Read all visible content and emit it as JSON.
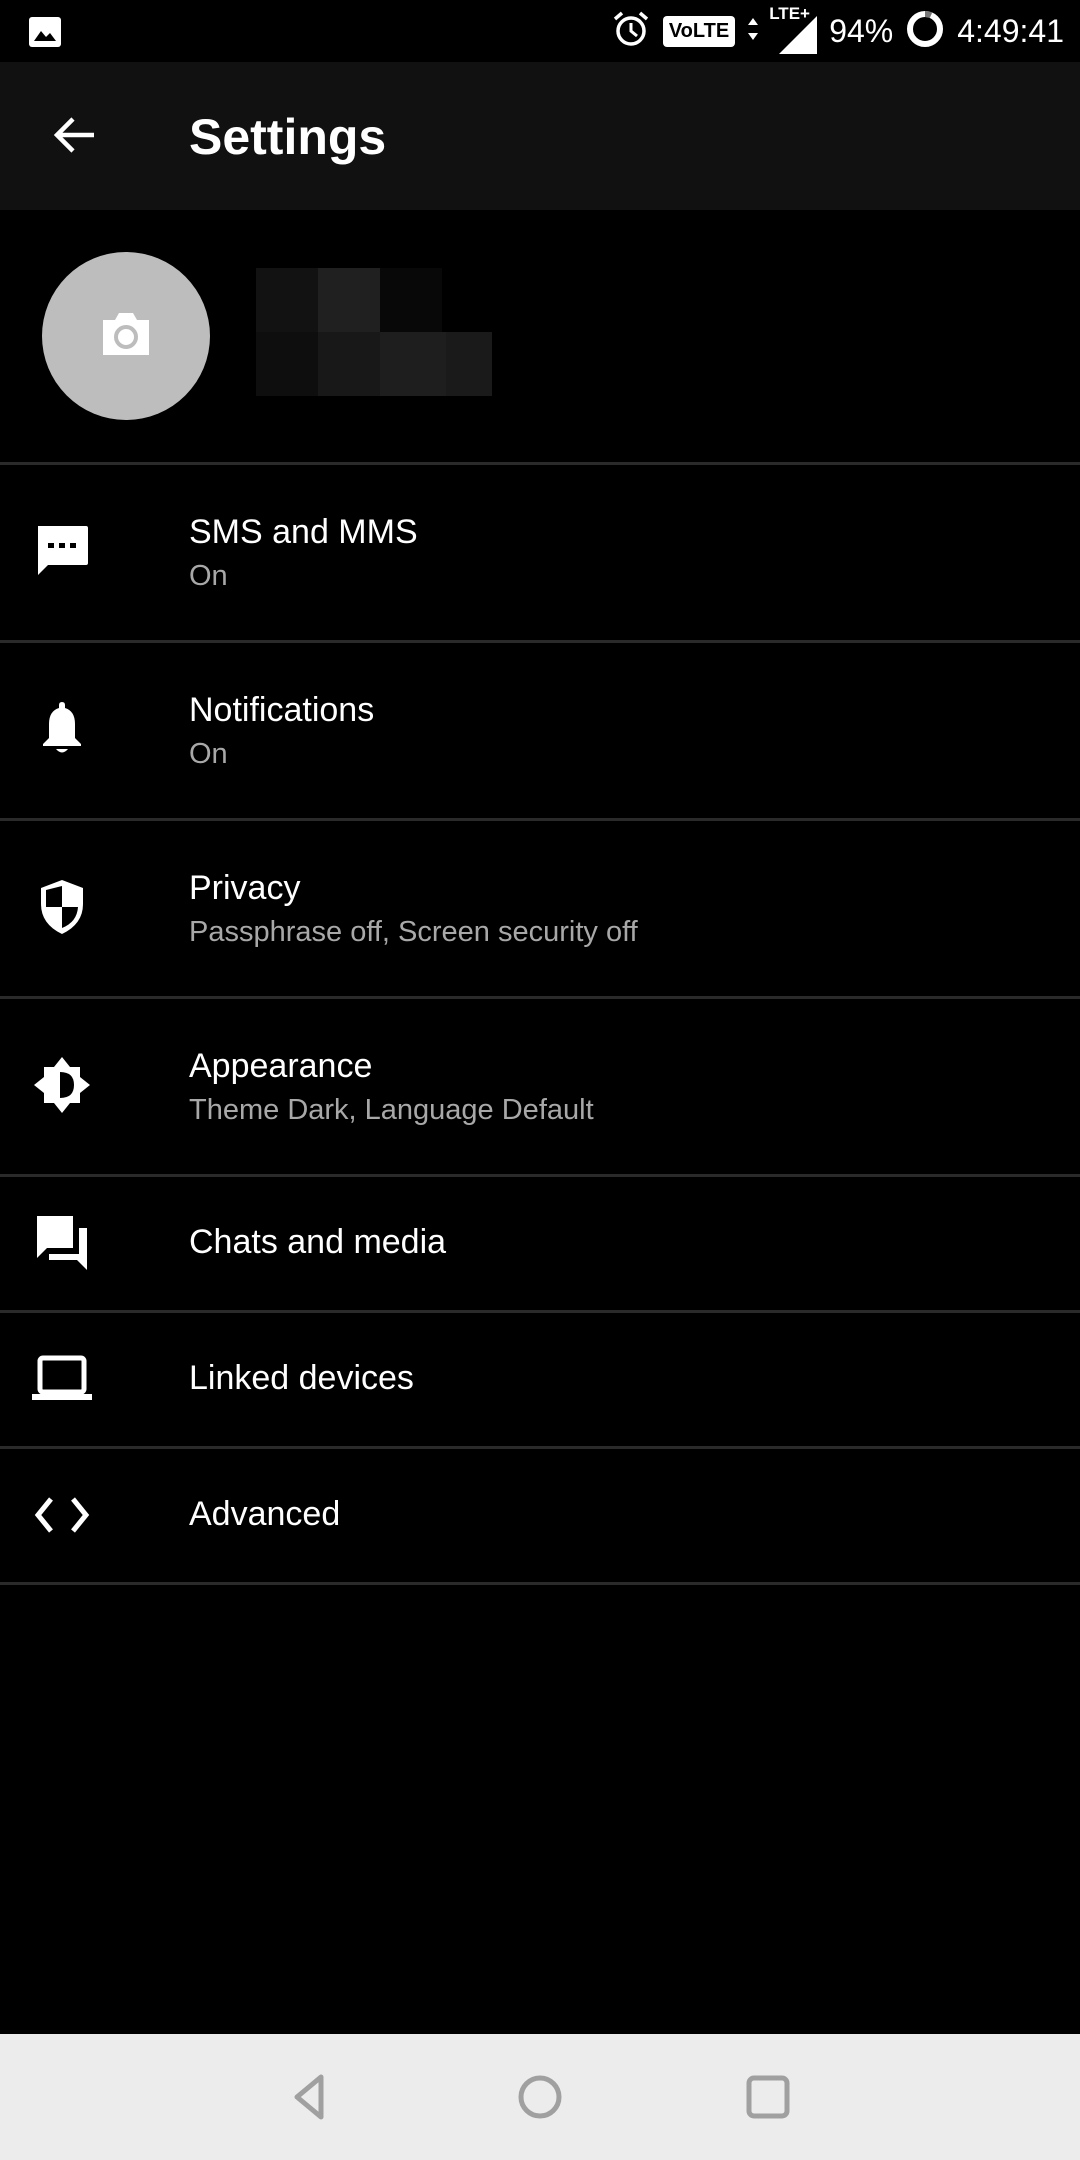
{
  "status_bar": {
    "battery": "94%",
    "time": "4:49:41",
    "volte_label": "VoLTE",
    "network_label": "LTE+",
    "icons": [
      "image-notification-icon",
      "alarm-icon",
      "volte-icon",
      "data-arrows-icon",
      "signal-icon",
      "battery-ring-icon"
    ]
  },
  "toolbar": {
    "title": "Settings",
    "back_icon": "arrow-left-icon"
  },
  "profile": {
    "avatar_icon": "camera-icon",
    "name_redacted": true
  },
  "settings": [
    {
      "id": "sms",
      "label": "SMS and MMS",
      "summary": "On",
      "icon": "message-icon"
    },
    {
      "id": "notifications",
      "label": "Notifications",
      "summary": "On",
      "icon": "bell-icon"
    },
    {
      "id": "privacy",
      "label": "Privacy",
      "summary": "Passphrase off, Screen security off",
      "icon": "shield-icon"
    },
    {
      "id": "appearance",
      "label": "Appearance",
      "summary": "Theme Dark, Language Default",
      "icon": "brightness-icon"
    },
    {
      "id": "chats",
      "label": "Chats and media",
      "summary": null,
      "icon": "forum-icon"
    },
    {
      "id": "linked",
      "label": "Linked devices",
      "summary": null,
      "icon": "laptop-icon"
    },
    {
      "id": "advanced",
      "label": "Advanced",
      "summary": null,
      "icon": "code-icon"
    }
  ],
  "nav_bar": {
    "buttons": [
      "back",
      "home",
      "recents"
    ]
  },
  "colors": {
    "background": "#000000",
    "toolbar": "#111111",
    "divider": "#2a2a2a",
    "summary_text": "#a8a8a8",
    "avatar": "#bdbdbd",
    "nav_bar": "#ececec",
    "nav_icon": "#a0a0a0"
  }
}
